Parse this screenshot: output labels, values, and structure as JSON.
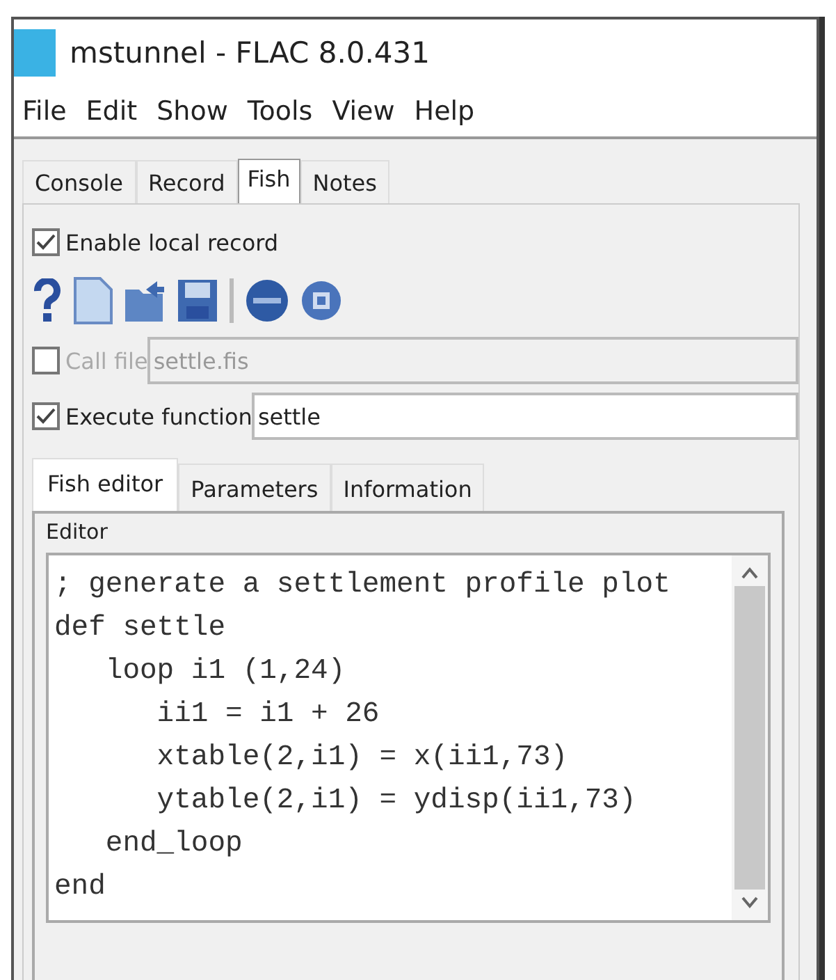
{
  "window": {
    "title": "mstunnel - FLAC 8.0.431"
  },
  "menu": [
    "File",
    "Edit",
    "Show",
    "Tools",
    "View",
    "Help"
  ],
  "tabs": [
    {
      "label": "Console",
      "selected": false
    },
    {
      "label": "Record",
      "selected": false
    },
    {
      "label": "Fish",
      "selected": true
    },
    {
      "label": "Notes",
      "selected": false
    }
  ],
  "enable_local_record": {
    "label": "Enable local record",
    "checked": true
  },
  "call_file": {
    "label": "Call file",
    "checked": false,
    "value": "settle.fis"
  },
  "execute_function": {
    "label": "Execute function",
    "checked": true,
    "value": "settle"
  },
  "sub_tabs": [
    {
      "label": "Fish editor",
      "selected": true
    },
    {
      "label": "Parameters",
      "selected": false
    },
    {
      "label": "Information",
      "selected": false
    }
  ],
  "editor": {
    "title": "Editor",
    "lines": [
      "; generate a settlement profile plot",
      "def settle",
      "   loop i1 (1,24)",
      "      ii1 = i1 + 26",
      "      xtable(2,i1) = x(ii1,73)",
      "      ytable(2,i1) = ydisp(ii1,73)",
      "   end_loop",
      "end"
    ]
  }
}
